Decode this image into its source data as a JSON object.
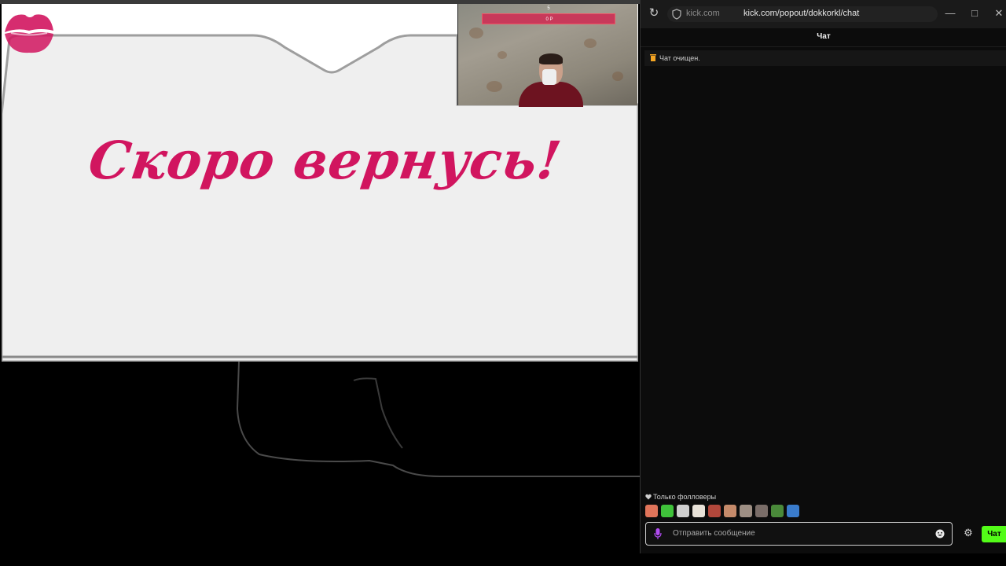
{
  "stream": {
    "overlay_text": "Скоро вернусь!",
    "webcam": {
      "bar_top": "5",
      "bar_value": "0 P"
    }
  },
  "browser": {
    "domain": "kick.com",
    "url": "kick.com/popout/dokkorkl/chat",
    "window_controls": {
      "minimize": "—",
      "maximize": "□",
      "close": "✕"
    }
  },
  "chat": {
    "title": "Чат",
    "notice": "Чат очищен.",
    "followers_only": "Только фолловеры",
    "emotes": [
      {
        "name": "emote-1",
        "color": "#e0745a"
      },
      {
        "name": "emote-2",
        "color": "#3fc23a"
      },
      {
        "name": "emote-3",
        "color": "#cfcfcf"
      },
      {
        "name": "emote-4",
        "color": "#e8e2d8"
      },
      {
        "name": "emote-5",
        "color": "#b2473b"
      },
      {
        "name": "emote-6",
        "color": "#c58a6a"
      },
      {
        "name": "emote-7",
        "color": "#9e8f84"
      },
      {
        "name": "emote-8",
        "color": "#7a6d68"
      },
      {
        "name": "emote-9",
        "color": "#4a8a3a"
      },
      {
        "name": "emote-10",
        "color": "#3a7ccc"
      }
    ],
    "input_placeholder": "Отправить сообщение",
    "send_label": "Чат",
    "accent_color": "#53fc18"
  }
}
